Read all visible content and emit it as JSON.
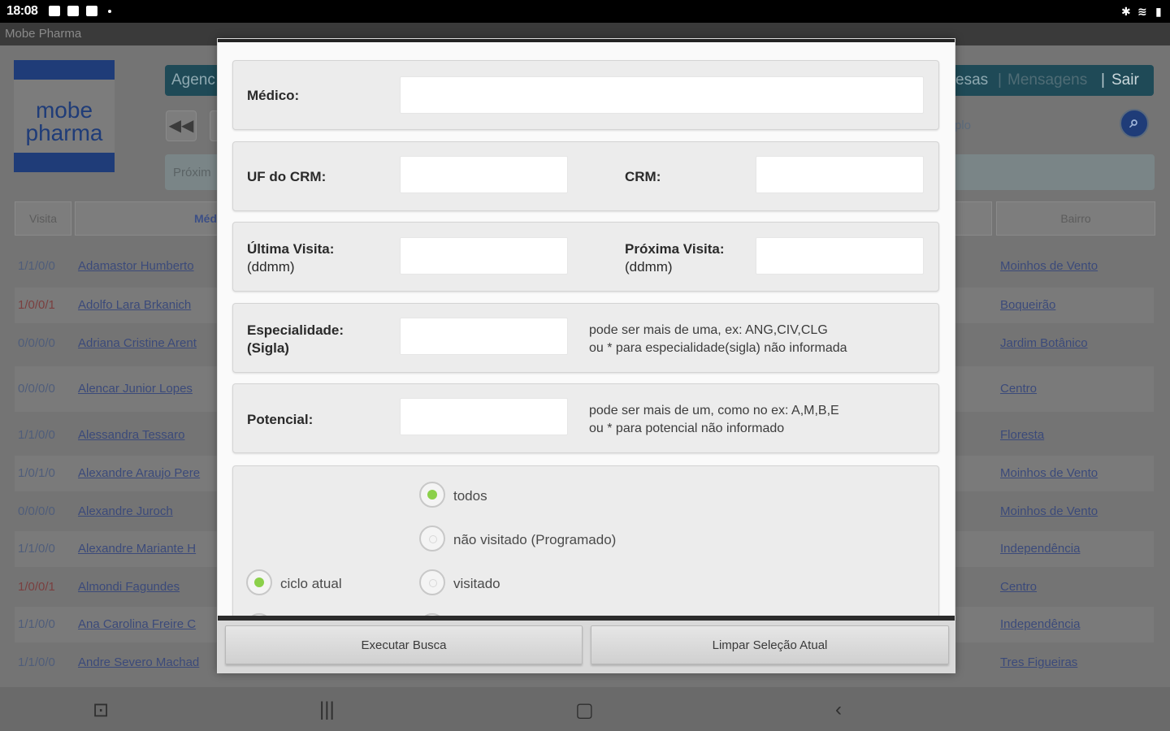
{
  "status_bar": {
    "time": "18:08"
  },
  "app_title": "Mobe Pharma",
  "logo": {
    "line1": "mobe",
    "line2": "pharma"
  },
  "background": {
    "nav_left": "Agenc",
    "nav_right": {
      "a": "esas",
      "sep1": "|",
      "b": "Mensagens",
      "sep2": "|",
      "c": "Sair"
    },
    "band_label": "Próxim",
    "side_label": "plo",
    "headers": {
      "visita": "Visita",
      "medico": "Méd",
      "bairro": "Bairro"
    },
    "rows": [
      {
        "visita": "1/1/0/0",
        "medico": "Adamastor Humberto",
        "bairro": "Moinhos de Vento",
        "red": false
      },
      {
        "visita": "1/0/0/1",
        "medico": "Adolfo Lara Brkanich",
        "bairro": "Boqueirão",
        "red": true
      },
      {
        "visita": "0/0/0/0",
        "medico": "Adriana Cristine Arent",
        "bairro": "Jardim Botânico",
        "red": false
      },
      {
        "visita": "0/0/0/0",
        "medico": "Alencar Junior Lopes",
        "bairro": "Centro",
        "red": false
      },
      {
        "visita": "1/1/0/0",
        "medico": "Alessandra Tessaro",
        "bairro": "Floresta",
        "red": false
      },
      {
        "visita": "1/0/1/0",
        "medico": "Alexandre Araujo Pere",
        "bairro": "Moinhos de Vento",
        "red": false
      },
      {
        "visita": "0/0/0/0",
        "medico": "Alexandre Juroch",
        "bairro": "Moinhos de Vento",
        "red": false
      },
      {
        "visita": "1/1/0/0",
        "medico": "Alexandre Mariante H",
        "bairro": "Independência",
        "red": false
      },
      {
        "visita": "1/0/0/1",
        "medico": "Almondi Fagundes",
        "bairro": "Centro",
        "red": true
      },
      {
        "visita": "1/1/0/0",
        "medico": "Ana Carolina Freire C",
        "bairro": "Independência",
        "red": false
      },
      {
        "visita": "1/1/0/0",
        "medico": "Andre Severo Machad",
        "bairro": "Tres Figueiras",
        "red": false
      }
    ]
  },
  "modal": {
    "medico_label": "Médico:",
    "uf_crm_label": "UF do CRM:",
    "crm_label": "CRM:",
    "ultima_label": "Última Visita:",
    "ultima_fmt": "(ddmm)",
    "proxima_label": "Próxima Visita:",
    "proxima_fmt": "(ddmm)",
    "esp_label": "Especialidade:",
    "esp_sub": "(Sigla)",
    "esp_hint1": "pode ser mais de uma, ex: ANG,CIV,CLG",
    "esp_hint2": "ou * para especialidade(sigla) não informada",
    "pot_label": "Potencial:",
    "pot_hint1": "pode ser mais de um, como no ex: A,M,B,E",
    "pot_hint2": "ou * para potencial não informado",
    "radio_todos": "todos",
    "radio_nao_visitado": "não visitado (Programado)",
    "radio_visitado": "visitado",
    "radio_ciclo_atual": "ciclo atual",
    "btn_executar": "Executar Busca",
    "btn_limpar": "Limpar Seleção Atual"
  }
}
